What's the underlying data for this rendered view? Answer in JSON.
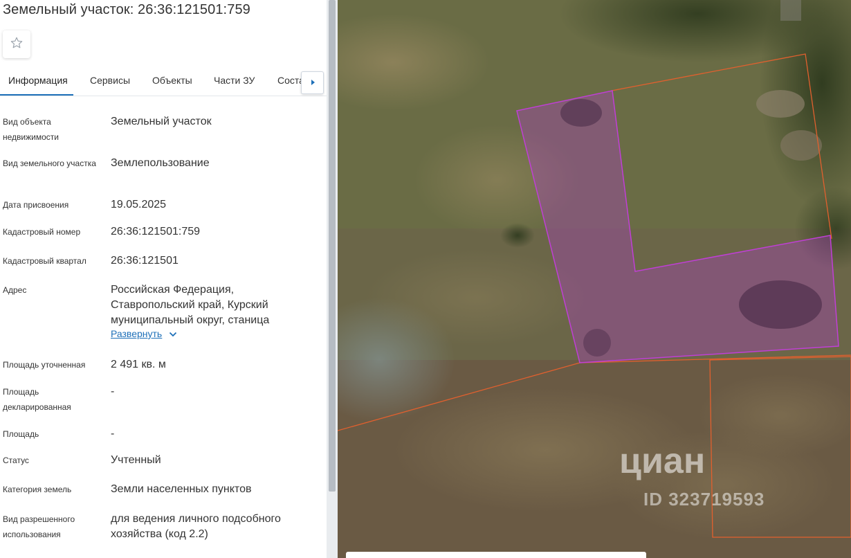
{
  "header": {
    "title": "Земельный участок: 26:36:121501:759"
  },
  "tabs": [
    {
      "label": "Информация"
    },
    {
      "label": "Сервисы"
    },
    {
      "label": "Объекты"
    },
    {
      "label": "Части ЗУ"
    },
    {
      "label": "Состав ЕЗ"
    }
  ],
  "active_tab": "Информация",
  "fields": [
    {
      "label": "Вид объекта недвижимости",
      "value": "Земельный участок"
    },
    {
      "label": "Вид земельного участка",
      "value": "Землепользование"
    },
    {
      "label": "Дата присвоения",
      "value": "19.05.2025"
    },
    {
      "label": "Кадастровый номер",
      "value": "26:36:121501:759"
    },
    {
      "label": "Кадастровый квартал",
      "value": "26:36:121501"
    },
    {
      "label": "Адрес",
      "value": "Российская Федерация, Ставропольский край, Курский муниципальный округ, станица"
    },
    {
      "label": "Площадь уточненная",
      "value": "2 491 кв. м"
    },
    {
      "label": "Площадь декларированная",
      "value": "-"
    },
    {
      "label": "Площадь",
      "value": "-"
    },
    {
      "label": "Статус",
      "value": "Учтенный"
    },
    {
      "label": "Категория земель",
      "value": "Земли населенных пунктов"
    },
    {
      "label": "Вид разрешенного использования",
      "value": "для ведения личного подсобного хозяйства (код 2.2)"
    }
  ],
  "expand_link": "Развернуть",
  "map": {
    "watermark_logo": "циан",
    "watermark_id": "ID 323719593",
    "parcel_color": "#b03cc8",
    "boundary_color": "#e2602e"
  },
  "colors": {
    "accent": "#1d6fb8"
  }
}
